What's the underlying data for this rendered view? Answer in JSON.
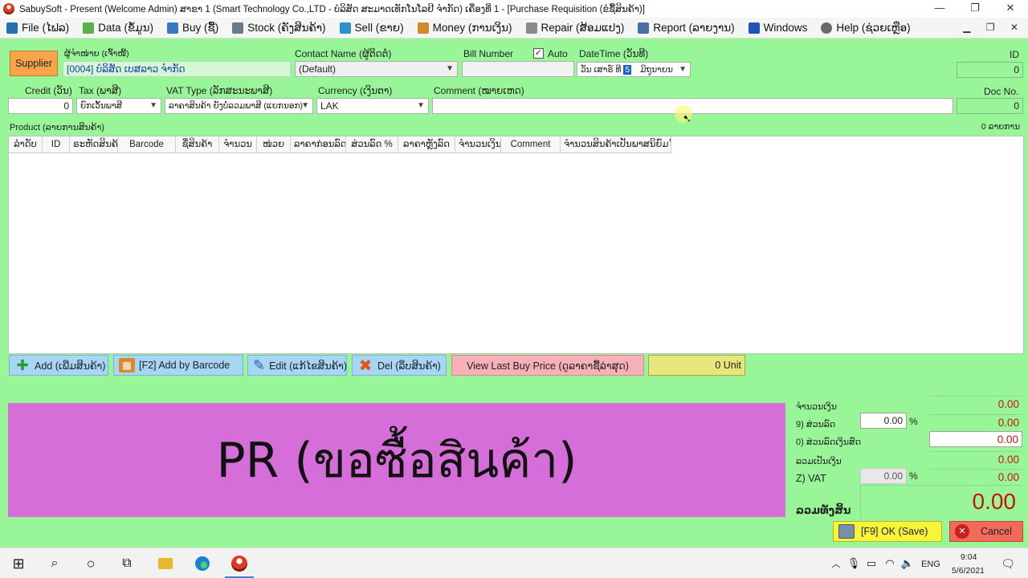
{
  "window": {
    "title": "SabuySoft - Present (Welcome Admin) ສາຂາ 1 (Smart Technology Co.,LTD - ບໍລິສັດ ສະມາດເທັກໂນໂລຢີ ຈໍາກັດ) ເຄື່ອງທີ່ 1 - [Purchase Requisition (ຂໍຊື້ສິນຄ້າ)]",
    "minimize": "—",
    "restore": "❐",
    "close": "✕"
  },
  "menu": {
    "items": [
      {
        "label": "File (ໄຟລ)",
        "color": "#2a6fb0"
      },
      {
        "label": "Data (ຂໍ້ມູນ)",
        "color": "#5bb04a"
      },
      {
        "label": "Buy (ຊື້)",
        "color": "#3b78c4"
      },
      {
        "label": "Stock (ຄັງສິນຄ້າ)",
        "color": "#6b7a8a"
      },
      {
        "label": "Sell (ຂາຍ)",
        "color": "#2f8fd0"
      },
      {
        "label": "Money (ການເງິນ)",
        "color": "#d08a2a"
      },
      {
        "label": "Repair (ສ້ອມແປງ)",
        "color": "#8a8a8a"
      },
      {
        "label": "Report (ລາຍງານ)",
        "color": "#4a6fa8"
      },
      {
        "label": "Windows",
        "color": "#2451b8"
      },
      {
        "label": "Help (ຊ່ວຍເຫຼືອ)",
        "color": "#6a6a6a"
      }
    ],
    "mdi_controls": "▁ ❐ ✕"
  },
  "form": {
    "supplier_button": "Supplier",
    "supplier_label": "ຜູ້ຈໍາໜ່າຍ (ເຈົ້າໜີ້)",
    "supplier_value": "[0004] ບໍລິສັດ ເບສລາວ ຈໍາກັດ",
    "contact_label": "Contact Name (ຜູ້ຕິດຕໍ່)",
    "contact_value": "(Default)",
    "bill_label": "Bill Number",
    "bill_value": "",
    "auto_label": "Auto",
    "datetime_label": "DateTime (ວັນທີ)",
    "datetime_prefix": "ວັນ   ເສາຣ໌   ທີ",
    "datetime_day": "5",
    "datetime_month": "ມິຖຸນາຍນ",
    "id_label": "ID",
    "id_value": "0",
    "credit_label": "Credit (ວັນ)",
    "credit_value": "0",
    "tax_label": "Tax (ພາສີ)",
    "tax_value": "ຍົກເວັ້ນພາສີ",
    "vat_type_label": "VAT Type (ລັກສະນະພາສີ)",
    "vat_type_value": "ລາຄາສິນຄ້າ ຍັງບໍ່ລວມພາສີ (ແຍກນອກ)",
    "currency_label": "Currency (ເງິນຕາ)",
    "currency_value": "LAK",
    "comment_label": "Comment (ໝາຍເຫດ)",
    "comment_value": "",
    "docno_label": "Doc No.",
    "docno_value": "0"
  },
  "product": {
    "label": "Product (ລາຍການສິນຄ້າ)",
    "count": "0 ລາຍການ",
    "columns": [
      "ລໍາດັບ",
      "ID",
      "ຣະຫັດສິນຄ້າ",
      "Barcode",
      "ຊື່ສິນຄ້າ",
      "ຈໍານວນ",
      "ໜ່ວຍ",
      "ລາຄາກ່ອນລົດ",
      "ສ່ວນລົດ %",
      "ລາຄາຫຼັງລົດ",
      "ຈໍານວນເງິນ",
      "Comment",
      "ຈໍານວນສິນຄ້າເປັນພາສນິຍົມໄດ້"
    ]
  },
  "actions": {
    "add": "Add (ເພີ່ມສິນຄ້າ)",
    "add_barcode": "[F2] Add by Barcode",
    "edit": "Edit (ແກ້ໄຂສິນຄ້າ)",
    "del": "Del (ລຶບສິນຄ້າ)",
    "last_price": "View Last Buy Price (ດູລາຄາຊື້ລ່າສຸດ)",
    "units": "0 Unit"
  },
  "banner": {
    "text": "PR (ขอซื้อสินค้า)"
  },
  "totals": {
    "amount_label": "ຈໍານວນເງິນ",
    "amount_value": "0.00",
    "discount_label": "9) ສ່ວນລົດ",
    "discount_pct": "0.00",
    "pct_sign": "%",
    "discount_value": "0.00",
    "cash_discount_label": "0) ສ່ວນລົດເງິນສົດ",
    "cash_discount_value": "0.00",
    "subtotal_label": "ລວມເປັນເງິນ",
    "subtotal_value": "0.00",
    "vat_label": "Z)  VAT",
    "vat_pct": "0.00",
    "vat_value": "0.00",
    "grand_label": "ລວມທັງສິ້ນ",
    "grand_value": "0.00"
  },
  "footer": {
    "ok": "[F9] OK (Save)",
    "cancel": "Cancel"
  },
  "taskbar": {
    "lang": "ENG",
    "time": "9:04",
    "date": "5/6/2021"
  }
}
